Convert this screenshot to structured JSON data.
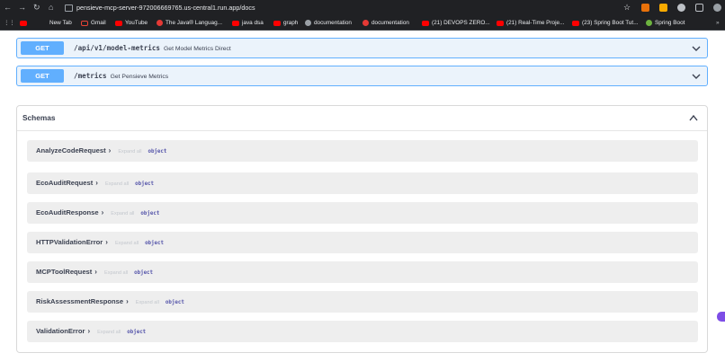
{
  "browser": {
    "url": "pensieve-mcp-server-972006669765.us-central1.run.app/docs",
    "bookmarks": [
      {
        "label": "New Tab",
        "icon": "new-tab-icon"
      },
      {
        "label": "Gmail",
        "icon": "gmail-icon"
      },
      {
        "label": "YouTube",
        "icon": "youtube-icon"
      },
      {
        "label": "The Java® Languag...",
        "icon": "java-icon"
      },
      {
        "label": "java dsa",
        "icon": "youtube-icon"
      },
      {
        "label": "graph",
        "icon": "youtube-icon"
      },
      {
        "label": "documentation",
        "icon": "globe-icon"
      },
      {
        "label": "documentation",
        "icon": "java-icon"
      },
      {
        "label": "(21) DEVOPS ZERO...",
        "icon": "youtube-icon"
      },
      {
        "label": "(21) Real-Time Proje...",
        "icon": "youtube-icon"
      },
      {
        "label": "(23) Spring Boot Tut...",
        "icon": "youtube-icon"
      },
      {
        "label": "Spring Boot",
        "icon": "spring-icon"
      }
    ]
  },
  "operations": [
    {
      "method": "GET",
      "path": "/api/v1/model-metrics",
      "summary": "Get Model Metrics Direct"
    },
    {
      "method": "GET",
      "path": "/metrics",
      "summary": "Get Pensieve Metrics"
    }
  ],
  "schemas": {
    "title": "Schemas",
    "expand_label": "Expand all",
    "type_label": "object",
    "models": [
      "AnalyzeCodeRequest",
      "EcoAuditRequest",
      "EcoAuditResponse",
      "HTTPValidationError",
      "MCPToolRequest",
      "RiskAssessmentResponse",
      "ValidationError"
    ]
  },
  "colors": {
    "get_accent": "#61affe",
    "get_background": "#ebf3fb",
    "model_background": "#eeeeee",
    "text": "#3b4151"
  }
}
